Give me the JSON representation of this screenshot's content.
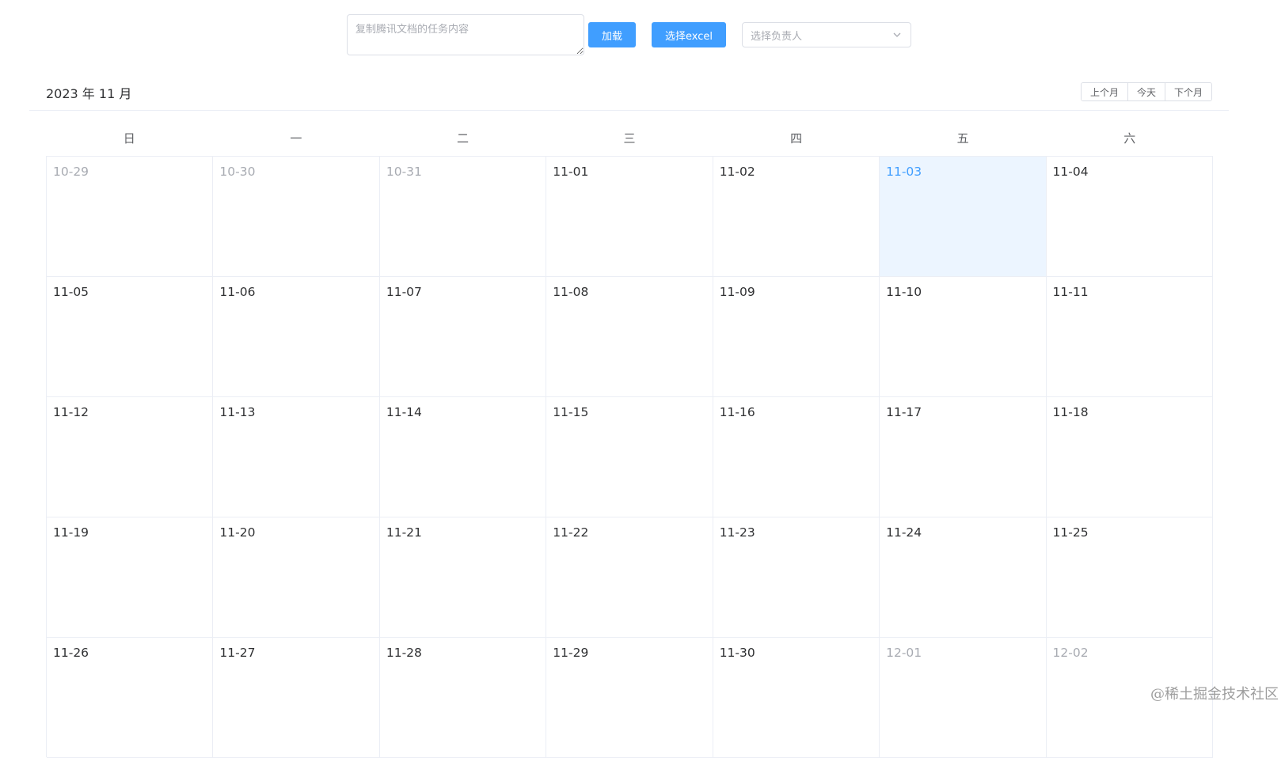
{
  "toolbar": {
    "textarea_placeholder": "复制腾讯文档的任务内容",
    "load_label": "加载",
    "excel_label": "选择excel",
    "owner_placeholder": "选择负责人",
    "accent_color": "#409eff"
  },
  "calendar": {
    "title": "2023 年 11 月",
    "prev_label": "上个月",
    "today_label": "今天",
    "next_label": "下个月",
    "weekdays": [
      "日",
      "一",
      "二",
      "三",
      "四",
      "五",
      "六"
    ],
    "weeks": [
      [
        {
          "date": "10-29",
          "state": "other"
        },
        {
          "date": "10-30",
          "state": "other"
        },
        {
          "date": "10-31",
          "state": "other"
        },
        {
          "date": "11-01",
          "state": "current"
        },
        {
          "date": "11-02",
          "state": "current"
        },
        {
          "date": "11-03",
          "state": "today"
        },
        {
          "date": "11-04",
          "state": "current"
        }
      ],
      [
        {
          "date": "11-05",
          "state": "current"
        },
        {
          "date": "11-06",
          "state": "current"
        },
        {
          "date": "11-07",
          "state": "current"
        },
        {
          "date": "11-08",
          "state": "current"
        },
        {
          "date": "11-09",
          "state": "current"
        },
        {
          "date": "11-10",
          "state": "current"
        },
        {
          "date": "11-11",
          "state": "current"
        }
      ],
      [
        {
          "date": "11-12",
          "state": "current"
        },
        {
          "date": "11-13",
          "state": "current"
        },
        {
          "date": "11-14",
          "state": "current"
        },
        {
          "date": "11-15",
          "state": "current"
        },
        {
          "date": "11-16",
          "state": "current"
        },
        {
          "date": "11-17",
          "state": "current"
        },
        {
          "date": "11-18",
          "state": "current"
        }
      ],
      [
        {
          "date": "11-19",
          "state": "current"
        },
        {
          "date": "11-20",
          "state": "current"
        },
        {
          "date": "11-21",
          "state": "current"
        },
        {
          "date": "11-22",
          "state": "current"
        },
        {
          "date": "11-23",
          "state": "current"
        },
        {
          "date": "11-24",
          "state": "current"
        },
        {
          "date": "11-25",
          "state": "current"
        }
      ],
      [
        {
          "date": "11-26",
          "state": "current"
        },
        {
          "date": "11-27",
          "state": "current"
        },
        {
          "date": "11-28",
          "state": "current"
        },
        {
          "date": "11-29",
          "state": "current"
        },
        {
          "date": "11-30",
          "state": "current"
        },
        {
          "date": "12-01",
          "state": "other"
        },
        {
          "date": "12-02",
          "state": "other"
        }
      ]
    ]
  },
  "watermark": "@稀土掘金技术社区",
  "icons": {
    "select_arrow": "chevron-down-icon"
  }
}
